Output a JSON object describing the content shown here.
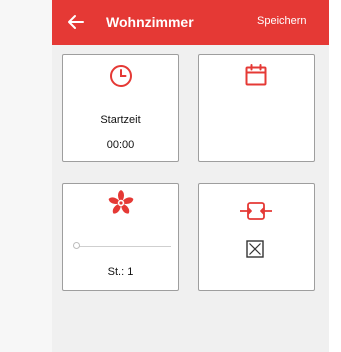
{
  "colors": {
    "accent": "#e53935",
    "tile_border": "#9e9e9e",
    "background": "#f0f0f0"
  },
  "header": {
    "title": "Wohnzimmer",
    "back_icon": "arrow-left-icon",
    "save_label": "Speichern"
  },
  "tiles": {
    "start_time": {
      "icon": "clock-icon",
      "label": "Startzeit",
      "value": "00:00"
    },
    "calendar": {
      "icon": "calendar-icon"
    },
    "fan": {
      "icon": "fan-icon",
      "level_label": "St.: 1",
      "slider_level": 0
    },
    "mode": {
      "icon": "compress-icon",
      "checkbox_icon": "x-box-icon"
    }
  }
}
